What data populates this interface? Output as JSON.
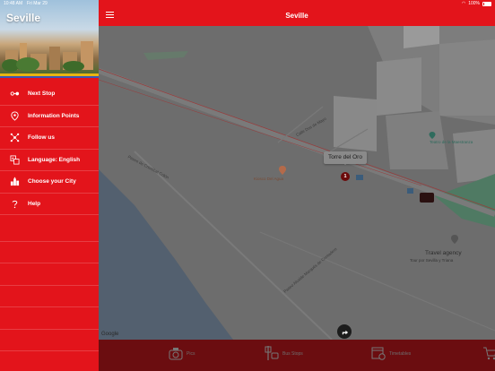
{
  "status_bar": {
    "time": "10:48 AM",
    "date": "Fri Mar 29",
    "battery": "100%"
  },
  "sidebar": {
    "city_title": "Seville",
    "items": [
      {
        "label": "Next Stop",
        "icon": "next-stop-icon"
      },
      {
        "label": "Information Points",
        "icon": "location-pin-icon"
      },
      {
        "label": "Follow us",
        "icon": "share-network-icon"
      },
      {
        "label": "Language: English",
        "icon": "translate-icon"
      },
      {
        "label": "Choose your City",
        "icon": "city-icon"
      },
      {
        "label": "Help",
        "icon": "help-icon"
      }
    ]
  },
  "header": {
    "title": "Seville"
  },
  "map": {
    "tooltip": "Torre del Oro",
    "stop_number": "1",
    "labels": {
      "street1": "Calle Dos de Mayo",
      "street2": "Paseo de Cristóbal Colón",
      "street3": "Paseo Alcalde Marqués de Contadero",
      "poi": "Kiosco Del Agua",
      "museum": "Teatro de la Maestranza",
      "agency": "Travel agency",
      "agency_sub": "Tour por Sevilla y Triana"
    },
    "attribution": "Google"
  },
  "bottom_bar": {
    "items": [
      {
        "label": "Pics",
        "icon": "camera-icon"
      },
      {
        "label": "Bus Stops",
        "icon": "bus-stop-icon"
      },
      {
        "label": "Timetables",
        "icon": "calendar-clock-icon"
      },
      {
        "label": "",
        "icon": "cart-icon"
      }
    ]
  },
  "colors": {
    "brand": "#e3141b",
    "bottom": "#6b0d10"
  }
}
